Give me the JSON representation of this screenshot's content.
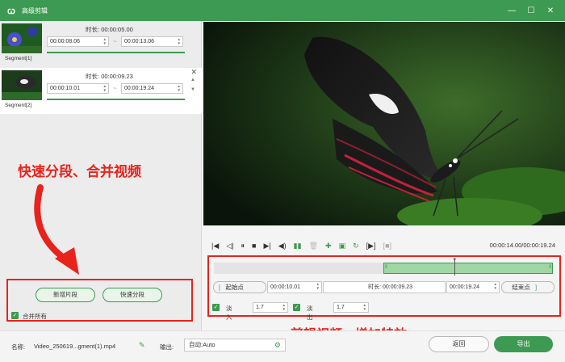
{
  "window": {
    "title": "高级剪辑",
    "min_icon": "minimize-icon",
    "max_icon": "maximize-icon",
    "close_icon": "close-icon"
  },
  "segments": [
    {
      "label": "Segment[1]",
      "duration_label": "时长:",
      "duration": "00:00:05.00",
      "start": "00:00:08.06",
      "end": "00:00:13.06"
    },
    {
      "label": "Segment[2]",
      "duration_label": "时长:",
      "duration": "00:00:09.23",
      "start": "00:00:10.01",
      "end": "00:00:19.24"
    }
  ],
  "annotations": {
    "left": "快速分段、合并视频",
    "bottom": "剪辑视频、增加特效"
  },
  "left_actions": {
    "add_segment": "新增片段",
    "quick_split": "快速分段",
    "merge_all": "合并所有"
  },
  "player": {
    "time_readout": "00:00:14.00/00:00:19.24",
    "icons": [
      "prev-icon",
      "step-back-icon",
      "pause-icon",
      "stop-icon",
      "step-forward-icon",
      "volume-icon",
      "split-icon",
      "delete-icon",
      "add-icon",
      "copy-icon",
      "refresh-icon",
      "mark-in-icon",
      "mark-out-icon"
    ]
  },
  "cut": {
    "start_label": "起始点",
    "start_value": "00:00:10.01",
    "duration_label": "时长:",
    "duration_value": "00:00:09.23",
    "end_value": "00:00:19.24",
    "end_label": "结束点",
    "fill_start_fraction": 0.5,
    "fill_end_fraction": 1.0,
    "playhead_fraction": 0.71
  },
  "effects": {
    "fade_in_label": "淡入",
    "fade_in_value": "1.7",
    "fade_out_label": "淡出",
    "fade_out_value": "1.7"
  },
  "bottom": {
    "name_label": "名称:",
    "name_value": "Video_250619...gment(1).mp4",
    "output_label": "输出:",
    "output_value": "自动:Auto",
    "back_button": "返回",
    "export_button": "导出"
  },
  "colors": {
    "accent": "#3d9a52",
    "annotation": "#e8231b",
    "track_fill": "#9fd6a3"
  }
}
